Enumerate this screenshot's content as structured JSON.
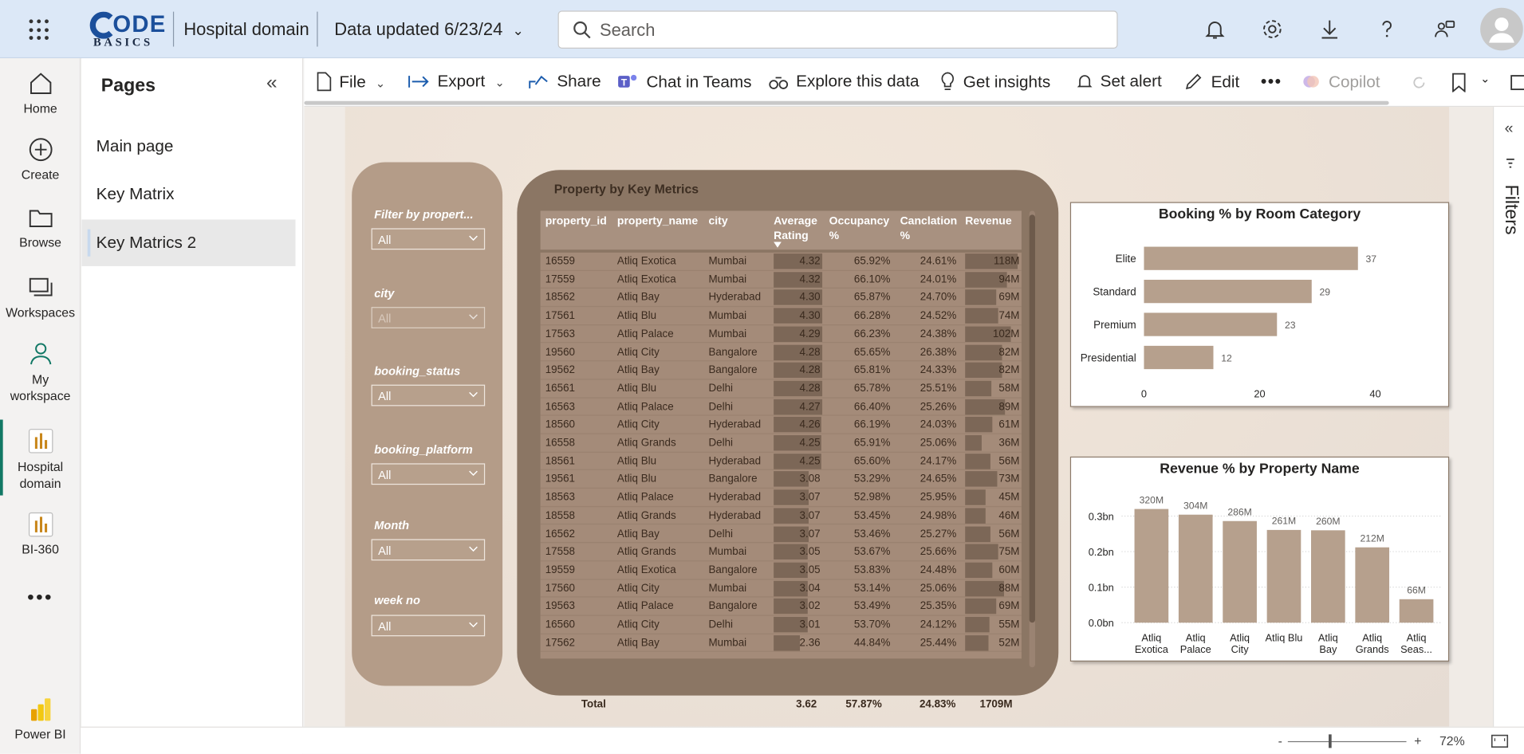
{
  "header": {
    "logo_big": "ODE",
    "logo_small": "BASICS",
    "workspace_title": "Hospital domain",
    "data_updated": "Data updated 6/23/24",
    "search_placeholder": "Search"
  },
  "rail": {
    "items": [
      {
        "label": "Home",
        "icon": "home-icon"
      },
      {
        "label": "Create",
        "icon": "plus-circle-icon"
      },
      {
        "label": "Browse",
        "icon": "folder-icon"
      },
      {
        "label": "Workspaces",
        "icon": "workspaces-icon"
      },
      {
        "label": "My workspace",
        "icon": "person-icon"
      },
      {
        "label": "Hospital domain",
        "icon": "report-icon"
      },
      {
        "label": "BI-360",
        "icon": "report-icon"
      },
      {
        "label": "Power BI",
        "icon": "powerbi-logo"
      }
    ]
  },
  "pages": {
    "title": "Pages",
    "items": [
      "Main page",
      "Key Matrix",
      "Key Matrics 2"
    ],
    "active": "Key Matrics 2"
  },
  "toolbar": {
    "file": "File",
    "export": "Export",
    "share": "Share",
    "chat": "Chat in Teams",
    "explore": "Explore this data",
    "insights": "Get insights",
    "alert": "Set alert",
    "edit": "Edit",
    "copilot": "Copilot"
  },
  "filters_label": "Filters",
  "slicers": [
    {
      "label": "Filter by propert...",
      "value": "All",
      "dimmed": false
    },
    {
      "label": "city",
      "value": "All",
      "dimmed": true
    },
    {
      "label": "booking_status",
      "value": "All",
      "dimmed": false
    },
    {
      "label": "booking_platform",
      "value": "All",
      "dimmed": false
    },
    {
      "label": "Month",
      "value": "All",
      "dimmed": false
    },
    {
      "label": "week no",
      "value": "All",
      "dimmed": false
    }
  ],
  "table": {
    "title": "Property by Key Metrics",
    "columns": [
      "property_id",
      "property_name",
      "city",
      "Average Rating",
      "Occupancy %",
      "Canclation %",
      "Revenue"
    ],
    "rows": [
      [
        "16559",
        "Atliq Exotica",
        "Mumbai",
        "4.32",
        "65.92%",
        "24.61%",
        "118M"
      ],
      [
        "17559",
        "Atliq Exotica",
        "Mumbai",
        "4.32",
        "66.10%",
        "24.01%",
        "94M"
      ],
      [
        "18562",
        "Atliq Bay",
        "Hyderabad",
        "4.30",
        "65.87%",
        "24.70%",
        "69M"
      ],
      [
        "17561",
        "Atliq Blu",
        "Mumbai",
        "4.30",
        "66.28%",
        "24.52%",
        "74M"
      ],
      [
        "17563",
        "Atliq Palace",
        "Mumbai",
        "4.29",
        "66.23%",
        "24.38%",
        "102M"
      ],
      [
        "19560",
        "Atliq City",
        "Bangalore",
        "4.28",
        "65.65%",
        "26.38%",
        "82M"
      ],
      [
        "19562",
        "Atliq Bay",
        "Bangalore",
        "4.28",
        "65.81%",
        "24.33%",
        "82M"
      ],
      [
        "16561",
        "Atliq Blu",
        "Delhi",
        "4.28",
        "65.78%",
        "25.51%",
        "58M"
      ],
      [
        "16563",
        "Atliq Palace",
        "Delhi",
        "4.27",
        "66.40%",
        "25.26%",
        "89M"
      ],
      [
        "18560",
        "Atliq City",
        "Hyderabad",
        "4.26",
        "66.19%",
        "24.03%",
        "61M"
      ],
      [
        "16558",
        "Atliq Grands",
        "Delhi",
        "4.25",
        "65.91%",
        "25.06%",
        "36M"
      ],
      [
        "18561",
        "Atliq Blu",
        "Hyderabad",
        "4.25",
        "65.60%",
        "24.17%",
        "56M"
      ],
      [
        "19561",
        "Atliq Blu",
        "Bangalore",
        "3.08",
        "53.29%",
        "24.65%",
        "73M"
      ],
      [
        "18563",
        "Atliq Palace",
        "Hyderabad",
        "3.07",
        "52.98%",
        "25.95%",
        "45M"
      ],
      [
        "18558",
        "Atliq Grands",
        "Hyderabad",
        "3.07",
        "53.45%",
        "24.98%",
        "46M"
      ],
      [
        "16562",
        "Atliq Bay",
        "Delhi",
        "3.07",
        "53.46%",
        "25.27%",
        "56M"
      ],
      [
        "17558",
        "Atliq Grands",
        "Mumbai",
        "3.05",
        "53.67%",
        "25.66%",
        "75M"
      ],
      [
        "19559",
        "Atliq Exotica",
        "Bangalore",
        "3.05",
        "53.83%",
        "24.48%",
        "60M"
      ],
      [
        "17560",
        "Atliq City",
        "Mumbai",
        "3.04",
        "53.14%",
        "25.06%",
        "88M"
      ],
      [
        "19563",
        "Atliq Palace",
        "Bangalore",
        "3.02",
        "53.49%",
        "25.35%",
        "69M"
      ],
      [
        "16560",
        "Atliq City",
        "Delhi",
        "3.01",
        "53.70%",
        "24.12%",
        "55M"
      ],
      [
        "17562",
        "Atliq Bay",
        "Mumbai",
        "2.36",
        "44.84%",
        "25.44%",
        "52M"
      ]
    ],
    "total": {
      "label": "Total",
      "rating": "3.62",
      "occupancy": "57.87%",
      "cancellation": "24.83%",
      "revenue": "1709M"
    }
  },
  "chart_data": [
    {
      "type": "bar",
      "orientation": "horizontal",
      "title": "Booking % by Room Category",
      "categories": [
        "Elite",
        "Standard",
        "Premium",
        "Presidential"
      ],
      "values": [
        37,
        29,
        23,
        12
      ],
      "xticks": [
        "0",
        "20",
        "40"
      ],
      "xlim": [
        0,
        40
      ],
      "color": "#b6a08d"
    },
    {
      "type": "bar",
      "orientation": "vertical",
      "title": "Revenue % by Property Name",
      "categories": [
        [
          "Atliq",
          "Exotica"
        ],
        [
          "Atliq",
          "Palace"
        ],
        [
          "Atliq",
          "City"
        ],
        [
          "Atliq Blu"
        ],
        [
          "Atliq",
          "Bay"
        ],
        [
          "Atliq",
          "Grands"
        ],
        [
          "Atliq",
          "Seas..."
        ]
      ],
      "values": [
        320,
        304,
        286,
        261,
        260,
        212,
        66
      ],
      "labels": [
        "320M",
        "304M",
        "286M",
        "261M",
        "260M",
        "212M",
        "66M"
      ],
      "yticks": [
        "0.0bn",
        "0.1bn",
        "0.2bn",
        "0.3bn"
      ],
      "ylim": [
        0,
        0.35
      ],
      "color": "#b6a08d"
    }
  ],
  "statusbar": {
    "minus": "-",
    "plus": "+",
    "zoom": "72%"
  }
}
